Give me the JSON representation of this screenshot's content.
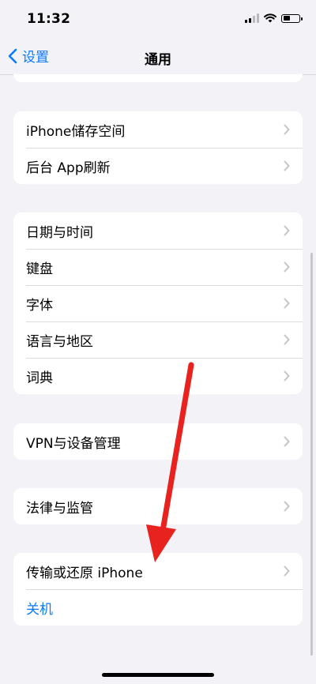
{
  "status_bar": {
    "time": "11:32",
    "battery_level": 0.45
  },
  "nav": {
    "back_label": "设置",
    "title": "通用"
  },
  "groups": [
    {
      "rows": [
        {
          "label": "iPhone储存空间"
        },
        {
          "label": "后台 App刷新"
        }
      ]
    },
    {
      "rows": [
        {
          "label": "日期与时间"
        },
        {
          "label": "键盘"
        },
        {
          "label": "字体"
        },
        {
          "label": "语言与地区"
        },
        {
          "label": "词典"
        }
      ]
    },
    {
      "rows": [
        {
          "label": "VPN与设备管理"
        }
      ]
    },
    {
      "rows": [
        {
          "label": "法律与监管"
        }
      ]
    },
    {
      "rows": [
        {
          "label": "传输或还原 iPhone"
        },
        {
          "label": "关机"
        }
      ]
    }
  ],
  "colors": {
    "accent": "#0a7aff",
    "background": "#f2f2f7",
    "annotation_arrow": "#e8231f"
  },
  "icons": {
    "back": "chevron-left-icon",
    "row_chevron": "chevron-right-icon",
    "wifi": "wifi-icon",
    "battery": "battery-icon",
    "signal": "cellular-signal-icon"
  }
}
